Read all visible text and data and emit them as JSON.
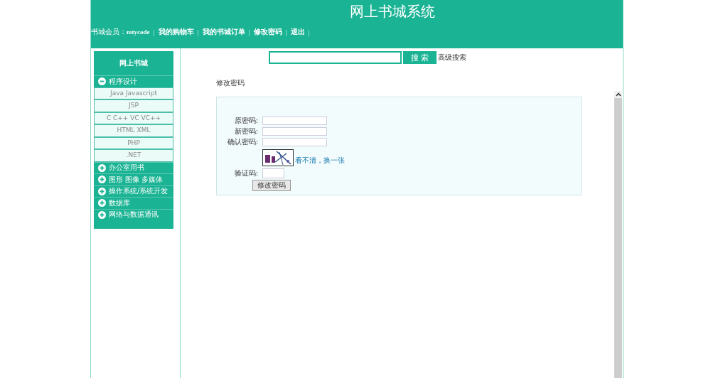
{
  "header": {
    "title": "网上书城系统",
    "member_label": "书城会员：",
    "username": "mtycode",
    "links": [
      "我的购物车",
      "我的书城订单",
      "修改密码",
      "退出"
    ],
    "separator": "|"
  },
  "sidebar": {
    "title": "网上书城",
    "categories": [
      {
        "label": "程序设计",
        "expanded": true,
        "children": [
          {
            "label": "Java Javascript"
          },
          {
            "label": "JSP"
          },
          {
            "label": "C C++ VC VC++"
          },
          {
            "label": "HTML XML"
          },
          {
            "label": "PHP"
          },
          {
            "label": ".NET"
          }
        ]
      },
      {
        "label": "办公室用书",
        "expanded": false
      },
      {
        "label": "图形 图像 多媒体",
        "expanded": false
      },
      {
        "label": "操作系统/系统开发",
        "expanded": false
      },
      {
        "label": "数据库",
        "expanded": false
      },
      {
        "label": "网络与数据通讯",
        "expanded": false
      }
    ]
  },
  "search": {
    "button": "搜 索",
    "advanced_link": "高级搜索"
  },
  "page_title": "修改密码",
  "form": {
    "fields": [
      {
        "label": "原密码:",
        "kind": "text"
      },
      {
        "label": "新密码:",
        "kind": "text"
      },
      {
        "label": "确认密码:",
        "kind": "text"
      },
      {
        "kind": "captcha",
        "refresh_link": "看不清，换一张"
      },
      {
        "label": "验证码:",
        "kind": "code"
      }
    ],
    "submit": "修改密码"
  }
}
